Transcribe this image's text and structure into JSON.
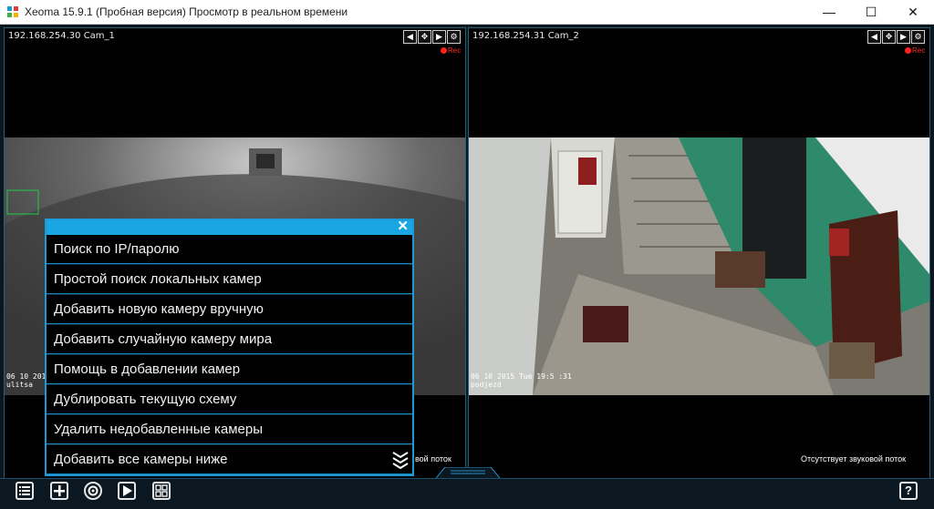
{
  "window": {
    "title": "Xeoma 15.9.1 (Пробная версия) Просмотр в реальном времени",
    "minimize": "—",
    "maximize": "☐",
    "close": "✕"
  },
  "cameras": [
    {
      "label": "192.168.254.30 Cam_1",
      "rec": "Rec",
      "stamp_date": "06 10 2015",
      "stamp_name": "ulitsa",
      "audio_status": "вой поток"
    },
    {
      "label": "192.168.254.31 Cam_2",
      "rec": "Rec",
      "stamp_date": "06 10 2015  Tue 19:5 :31",
      "stamp_name": "podjezd",
      "audio_status": "Отсутствует звуковой поток"
    }
  ],
  "menu": {
    "close": "✕",
    "items": [
      "Поиск по IP/паролю",
      "Простой поиск локальных камер",
      "Добавить новую камеру вручную",
      "Добавить случайную камеру мира",
      "Помощь в добавлении камер",
      "Дублировать текущую схему",
      "Удалить недобавленные камеры",
      "Добавить все камеры ниже"
    ]
  },
  "toolbar": {
    "help": "?"
  },
  "colors": {
    "accent": "#19a6e3",
    "panel_border": "#2b5c7a",
    "rec": "#ff2020"
  }
}
